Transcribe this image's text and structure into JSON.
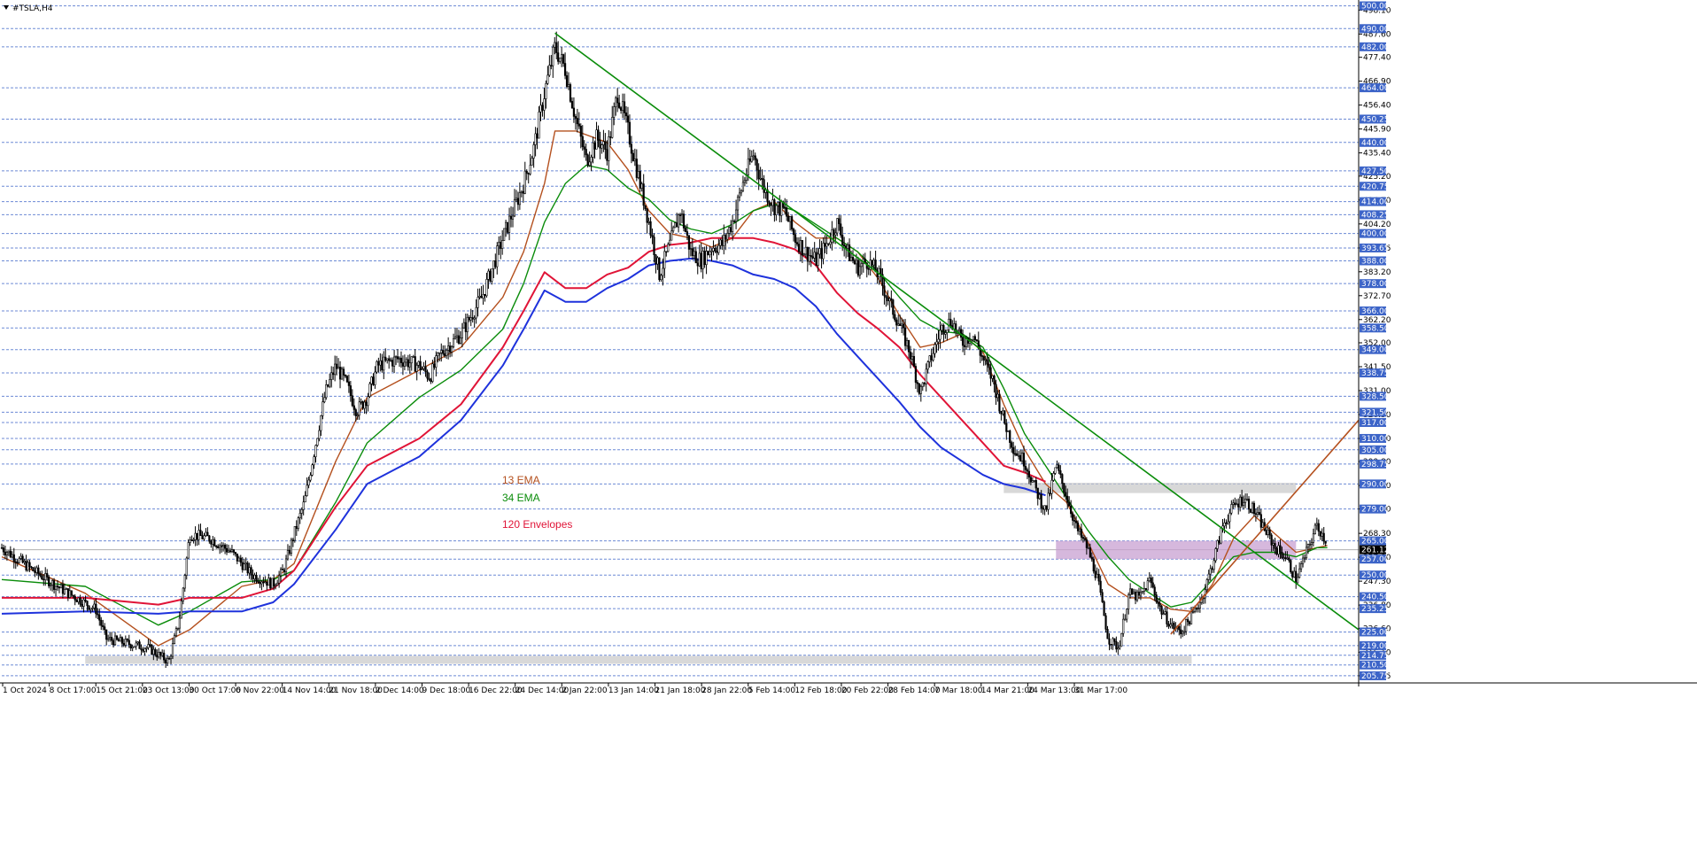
{
  "window": {
    "title": "#TSLA,H4"
  },
  "colors": {
    "background": "#ffffff",
    "grid": "#3c64c8",
    "candle": "#000000",
    "ema13": "#b4501e",
    "ema34": "#0a8c0a",
    "env_upper": "#e01437",
    "env_lower": "#1e32dc",
    "trend_down": "#0a8c0a",
    "trend_up": "#b4501e",
    "zone_gray": "#c8c8c8",
    "zone_purple": "#c8a0d2",
    "price_box": "#3c64c8",
    "current_box": "#000000"
  },
  "annotations": [
    {
      "id": "ema13",
      "text": "13 EMA",
      "color": "#b4501e"
    },
    {
      "id": "ema34",
      "text": "34 EMA",
      "color": "#0a8c0a"
    },
    {
      "id": "env120",
      "text": "120 Envelopes",
      "color": "#e01437"
    }
  ],
  "chart_data": {
    "type": "candlestick",
    "symbol": "#TSLA",
    "timeframe": "H4",
    "ylim": [
      203,
      501
    ],
    "y_axis_ticks": [
      "498.10",
      "487.60",
      "477.40",
      "466.90",
      "456.40",
      "445.90",
      "435.40",
      "425.20",
      "414.70",
      "404.20",
      "393.65",
      "383.20",
      "372.70",
      "362.20",
      "352.00",
      "341.50",
      "331.00",
      "320.50",
      "310.00",
      "299.80",
      "289.30",
      "279.00",
      "268.30",
      "257.80",
      "247.30",
      "236.80",
      "226.60",
      "216.10",
      "205.75"
    ],
    "level_lines": [
      "500.00",
      "490.00",
      "482.00",
      "464.00",
      "450.25",
      "440.00",
      "427.50",
      "420.75",
      "414.00",
      "408.25",
      "400.00",
      "393.65",
      "388.00",
      "378.00",
      "366.00",
      "358.50",
      "349.00",
      "338.75",
      "328.50",
      "321.50",
      "317.00",
      "310.00",
      "305.00",
      "298.75",
      "290.00",
      "279.00",
      "265.00",
      "257.00",
      "250.00",
      "240.50",
      "235.25",
      "225.00",
      "219.00",
      "214.75",
      "210.50",
      "205.75"
    ],
    "current_price": "261.12",
    "x_axis_labels": [
      "1 Oct 2024",
      "8 Oct 17:00",
      "15 Oct 21:00",
      "23 Oct 13:00",
      "30 Oct 17:00",
      "6 Nov 22:00",
      "14 Nov 14:00",
      "21 Nov 18:00",
      "2 Dec 14:00",
      "9 Dec 18:00",
      "16 Dec 22:00",
      "24 Dec 14:00",
      "2 Jan 22:00",
      "13 Jan 14:00",
      "21 Jan 18:00",
      "28 Jan 22:00",
      "5 Feb 14:00",
      "12 Feb 18:00",
      "20 Feb 22:00",
      "28 Feb 14:00",
      "7 Mar 18:00",
      "14 Mar 21:00",
      "24 Mar 13:00",
      "31 Mar 17:00"
    ],
    "price_path": [
      [
        0,
        262
      ],
      [
        3,
        252
      ],
      [
        6,
        243
      ],
      [
        9,
        235
      ],
      [
        10,
        222
      ],
      [
        12,
        220
      ],
      [
        14,
        218
      ],
      [
        16,
        212
      ],
      [
        17,
        230
      ],
      [
        18,
        268
      ],
      [
        20,
        266
      ],
      [
        22,
        260
      ],
      [
        24,
        250
      ],
      [
        26,
        246
      ],
      [
        27,
        252
      ],
      [
        28,
        268
      ],
      [
        29,
        282
      ],
      [
        30,
        306
      ],
      [
        31,
        330
      ],
      [
        32,
        342
      ],
      [
        33,
        334
      ],
      [
        34,
        322
      ],
      [
        35,
        328
      ],
      [
        36,
        342
      ],
      [
        38,
        345
      ],
      [
        40,
        342
      ],
      [
        41,
        337
      ],
      [
        42,
        347
      ],
      [
        44,
        356
      ],
      [
        46,
        372
      ],
      [
        48,
        398
      ],
      [
        50,
        422
      ],
      [
        51,
        438
      ],
      [
        52,
        462
      ],
      [
        53,
        482
      ],
      [
        54,
        472
      ],
      [
        55,
        450
      ],
      [
        56,
        432
      ],
      [
        57,
        442
      ],
      [
        58,
        436
      ],
      [
        59,
        462
      ],
      [
        60,
        445
      ],
      [
        61,
        425
      ],
      [
        62,
        405
      ],
      [
        63,
        382
      ],
      [
        64,
        395
      ],
      [
        65,
        410
      ],
      [
        66,
        392
      ],
      [
        67,
        388
      ],
      [
        68,
        394
      ],
      [
        69,
        395
      ],
      [
        70,
        405
      ],
      [
        71,
        422
      ],
      [
        72,
        435
      ],
      [
        73,
        420
      ],
      [
        74,
        412
      ],
      [
        75,
        410
      ],
      [
        76,
        398
      ],
      [
        77,
        392
      ],
      [
        78,
        388
      ],
      [
        79,
        395
      ],
      [
        80,
        405
      ],
      [
        81,
        392
      ],
      [
        82,
        385
      ],
      [
        83,
        388
      ],
      [
        84,
        382
      ],
      [
        85,
        370
      ],
      [
        86,
        360
      ],
      [
        87,
        348
      ],
      [
        88,
        330
      ],
      [
        89,
        345
      ],
      [
        90,
        358
      ],
      [
        91,
        362
      ],
      [
        92,
        352
      ],
      [
        93,
        356
      ],
      [
        94,
        345
      ],
      [
        95,
        335
      ],
      [
        96,
        318
      ],
      [
        97,
        305
      ],
      [
        98,
        300
      ],
      [
        99,
        288
      ],
      [
        100,
        278
      ],
      [
        101,
        298
      ],
      [
        102,
        285
      ],
      [
        103,
        270
      ],
      [
        104,
        262
      ],
      [
        105,
        248
      ],
      [
        106,
        222
      ],
      [
        107,
        218
      ],
      [
        108,
        242
      ],
      [
        109,
        240
      ],
      [
        110,
        248
      ],
      [
        111,
        235
      ],
      [
        112,
        228
      ],
      [
        113,
        225
      ],
      [
        114,
        232
      ],
      [
        115,
        240
      ],
      [
        116,
        255
      ],
      [
        117,
        272
      ],
      [
        118,
        280
      ],
      [
        119,
        284
      ],
      [
        120,
        278
      ],
      [
        121,
        270
      ],
      [
        122,
        262
      ],
      [
        123,
        258
      ],
      [
        124,
        248
      ],
      [
        125,
        260
      ],
      [
        126,
        272
      ],
      [
        127,
        264
      ]
    ],
    "series": [
      {
        "name": "13 EMA",
        "values": [
          [
            0,
            258
          ],
          [
            8,
            242
          ],
          [
            15,
            219
          ],
          [
            18,
            226
          ],
          [
            23,
            245
          ],
          [
            26,
            248
          ],
          [
            28,
            255
          ],
          [
            32,
            300
          ],
          [
            35,
            328
          ],
          [
            40,
            340
          ],
          [
            44,
            350
          ],
          [
            48,
            372
          ],
          [
            50,
            392
          ],
          [
            52,
            422
          ],
          [
            53,
            445
          ],
          [
            55,
            445
          ],
          [
            58,
            440
          ],
          [
            60,
            428
          ],
          [
            62,
            410
          ],
          [
            64,
            400
          ],
          [
            66,
            398
          ],
          [
            68,
            394
          ],
          [
            70,
            398
          ],
          [
            72,
            410
          ],
          [
            74,
            414
          ],
          [
            76,
            405
          ],
          [
            78,
            398
          ],
          [
            80,
            398
          ],
          [
            82,
            392
          ],
          [
            84,
            380
          ],
          [
            86,
            364
          ],
          [
            88,
            350
          ],
          [
            90,
            352
          ],
          [
            92,
            356
          ],
          [
            94,
            348
          ],
          [
            96,
            325
          ],
          [
            98,
            305
          ],
          [
            100,
            290
          ],
          [
            102,
            282
          ],
          [
            104,
            265
          ],
          [
            106,
            246
          ],
          [
            108,
            240
          ],
          [
            110,
            240
          ],
          [
            112,
            235
          ],
          [
            114,
            234
          ],
          [
            116,
            246
          ],
          [
            118,
            266
          ],
          [
            120,
            276
          ],
          [
            122,
            268
          ],
          [
            124,
            260
          ],
          [
            126,
            262
          ],
          [
            127,
            263
          ]
        ]
      },
      {
        "name": "34 EMA",
        "values": [
          [
            0,
            248
          ],
          [
            8,
            245
          ],
          [
            15,
            228
          ],
          [
            18,
            234
          ],
          [
            23,
            247
          ],
          [
            26,
            248
          ],
          [
            28,
            252
          ],
          [
            32,
            282
          ],
          [
            35,
            308
          ],
          [
            40,
            328
          ],
          [
            44,
            340
          ],
          [
            48,
            358
          ],
          [
            50,
            378
          ],
          [
            52,
            405
          ],
          [
            54,
            422
          ],
          [
            56,
            430
          ],
          [
            58,
            428
          ],
          [
            60,
            420
          ],
          [
            62,
            415
          ],
          [
            64,
            406
          ],
          [
            66,
            402
          ],
          [
            68,
            400
          ],
          [
            70,
            404
          ],
          [
            72,
            410
          ],
          [
            74,
            413
          ],
          [
            76,
            410
          ],
          [
            78,
            404
          ],
          [
            80,
            398
          ],
          [
            82,
            392
          ],
          [
            84,
            383
          ],
          [
            86,
            372
          ],
          [
            88,
            362
          ],
          [
            90,
            357
          ],
          [
            92,
            356
          ],
          [
            94,
            350
          ],
          [
            96,
            332
          ],
          [
            98,
            312
          ],
          [
            100,
            298
          ],
          [
            102,
            284
          ],
          [
            104,
            270
          ],
          [
            106,
            258
          ],
          [
            108,
            248
          ],
          [
            110,
            242
          ],
          [
            112,
            236
          ],
          [
            114,
            238
          ],
          [
            116,
            248
          ],
          [
            118,
            258
          ],
          [
            120,
            260
          ],
          [
            122,
            260
          ],
          [
            124,
            258
          ],
          [
            126,
            262
          ],
          [
            127,
            262
          ]
        ]
      },
      {
        "name": "120 Envelopes",
        "values": [
          [
            0,
            240
          ],
          [
            8,
            240
          ],
          [
            15,
            237
          ],
          [
            18,
            240
          ],
          [
            23,
            240
          ],
          [
            26,
            244
          ],
          [
            28,
            252
          ],
          [
            32,
            280
          ],
          [
            35,
            298
          ],
          [
            40,
            310
          ],
          [
            44,
            325
          ],
          [
            48,
            350
          ],
          [
            50,
            366
          ],
          [
            52,
            383
          ],
          [
            54,
            376
          ],
          [
            56,
            376
          ],
          [
            58,
            382
          ],
          [
            60,
            385
          ],
          [
            62,
            392
          ],
          [
            64,
            395
          ],
          [
            66,
            396
          ],
          [
            68,
            398
          ],
          [
            70,
            398
          ],
          [
            72,
            398
          ],
          [
            74,
            396
          ],
          [
            76,
            393
          ],
          [
            78,
            386
          ],
          [
            80,
            374
          ],
          [
            82,
            365
          ],
          [
            84,
            358
          ],
          [
            86,
            350
          ],
          [
            88,
            338
          ],
          [
            90,
            328
          ],
          [
            92,
            318
          ],
          [
            94,
            308
          ],
          [
            96,
            298
          ],
          [
            98,
            295
          ],
          [
            100,
            291
          ]
        ]
      },
      {
        "name": "120 Envelopes lower",
        "values": [
          [
            0,
            233
          ],
          [
            8,
            234
          ],
          [
            15,
            233
          ],
          [
            18,
            234
          ],
          [
            23,
            234
          ],
          [
            26,
            238
          ],
          [
            28,
            246
          ],
          [
            32,
            270
          ],
          [
            35,
            290
          ],
          [
            40,
            302
          ],
          [
            44,
            318
          ],
          [
            48,
            342
          ],
          [
            50,
            358
          ],
          [
            52,
            375
          ],
          [
            54,
            370
          ],
          [
            56,
            370
          ],
          [
            58,
            376
          ],
          [
            60,
            380
          ],
          [
            62,
            386
          ],
          [
            64,
            388
          ],
          [
            66,
            389
          ],
          [
            68,
            388
          ],
          [
            70,
            386
          ],
          [
            72,
            382
          ],
          [
            74,
            380
          ],
          [
            76,
            376
          ],
          [
            78,
            368
          ],
          [
            80,
            356
          ],
          [
            82,
            346
          ],
          [
            84,
            336
          ],
          [
            86,
            326
          ],
          [
            88,
            315
          ],
          [
            90,
            306
          ],
          [
            92,
            300
          ],
          [
            94,
            294
          ],
          [
            96,
            290
          ],
          [
            98,
            288
          ],
          [
            100,
            285
          ]
        ]
      }
    ],
    "trendlines": [
      {
        "id": "down",
        "from": [
          53,
          488
        ],
        "to": [
          130,
          226
        ]
      },
      {
        "id": "up",
        "from": [
          112,
          224
        ],
        "to": [
          130,
          318
        ]
      }
    ],
    "zones": [
      {
        "id": "bottom",
        "color": "gray",
        "x": [
          8,
          114
        ],
        "y": [
          211,
          214.5
        ]
      },
      {
        "id": "resistance",
        "color": "gray",
        "x": [
          96,
          124
        ],
        "y": [
          286,
          290.5
        ]
      },
      {
        "id": "support",
        "color": "purple",
        "x": [
          101,
          124
        ],
        "y": [
          257,
          265
        ]
      }
    ]
  }
}
